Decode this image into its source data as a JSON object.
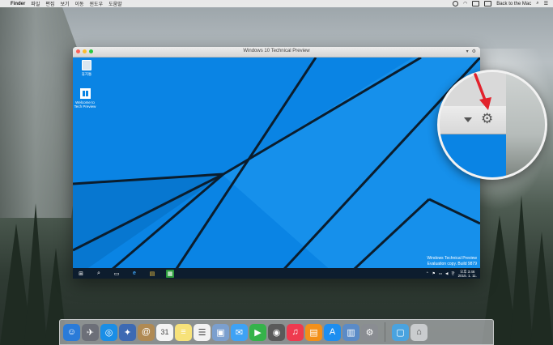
{
  "menubar": {
    "apple": "",
    "app_name": "Finder",
    "menus": [
      "파일",
      "편집",
      "보기",
      "이동",
      "윈도우",
      "도움말"
    ],
    "status_text": "Back to the Mac"
  },
  "window": {
    "title": "Windows 10 Technical Preview",
    "controls": {
      "dropdown": "▾",
      "gear": "⚙"
    }
  },
  "desktop_icons": [
    {
      "label": "휴지통",
      "icon": "recycle-bin-icon"
    },
    {
      "label": "Welcome to Tech Preview",
      "icon": "tech-preview-icon"
    }
  ],
  "watermark": {
    "line1": "Windows Technical Preview",
    "line2": "Evaluation copy. Build 9879"
  },
  "taskbar": {
    "items": [
      {
        "name": "start-button",
        "glyph": "⊞"
      },
      {
        "name": "search-button",
        "glyph": "⌕"
      },
      {
        "name": "task-view-button",
        "glyph": "▭"
      },
      {
        "name": "internet-explorer-button",
        "glyph": "e"
      },
      {
        "name": "file-explorer-button",
        "glyph": "▤"
      },
      {
        "name": "store-button",
        "glyph": "▦"
      }
    ],
    "tray_lang": "한",
    "clock_time": "오후 3:46",
    "clock_date": "2015. 1. 11."
  },
  "dock": {
    "apps": [
      {
        "name": "finder",
        "glyph": "☺",
        "color": "#2a7bd8"
      },
      {
        "name": "launchpad",
        "glyph": "✈",
        "color": "#6c6f78"
      },
      {
        "name": "safari",
        "glyph": "◎",
        "color": "#1a8ee6"
      },
      {
        "name": "iphoto",
        "glyph": "✦",
        "color": "#3d6ab3"
      },
      {
        "name": "contacts",
        "glyph": "@",
        "color": "#b08a53"
      },
      {
        "name": "calendar",
        "glyph": "31",
        "color": "#f4f4f4"
      },
      {
        "name": "notes",
        "glyph": "≡",
        "color": "#f7e27a"
      },
      {
        "name": "reminders",
        "glyph": "☰",
        "color": "#f2f2f2"
      },
      {
        "name": "preview",
        "glyph": "▣",
        "color": "#7b9fce"
      },
      {
        "name": "messages",
        "glyph": "✉",
        "color": "#3ea2f5"
      },
      {
        "name": "facetime",
        "glyph": "▶",
        "color": "#35b34a"
      },
      {
        "name": "photo-booth",
        "glyph": "◉",
        "color": "#5a5a5a"
      },
      {
        "name": "itunes",
        "glyph": "♫",
        "color": "#ee3a4f"
      },
      {
        "name": "ibooks",
        "glyph": "▤",
        "color": "#f39019"
      },
      {
        "name": "app-store",
        "glyph": "A",
        "color": "#1d8ef0"
      },
      {
        "name": "parallels",
        "glyph": "▥",
        "color": "#5b8bc7"
      },
      {
        "name": "system-preferences",
        "glyph": "⚙",
        "color": "#8a8d92"
      }
    ],
    "extras": [
      {
        "name": "downloads-folder",
        "glyph": "▢",
        "color": "#4aa3df"
      },
      {
        "name": "trash",
        "glyph": "⌂",
        "color": "#c9ccce"
      }
    ]
  },
  "colors": {
    "win_desktop_blue": "#0a84e4",
    "taskbar": "#0d1d2e",
    "annotation_red": "#e2222c"
  }
}
